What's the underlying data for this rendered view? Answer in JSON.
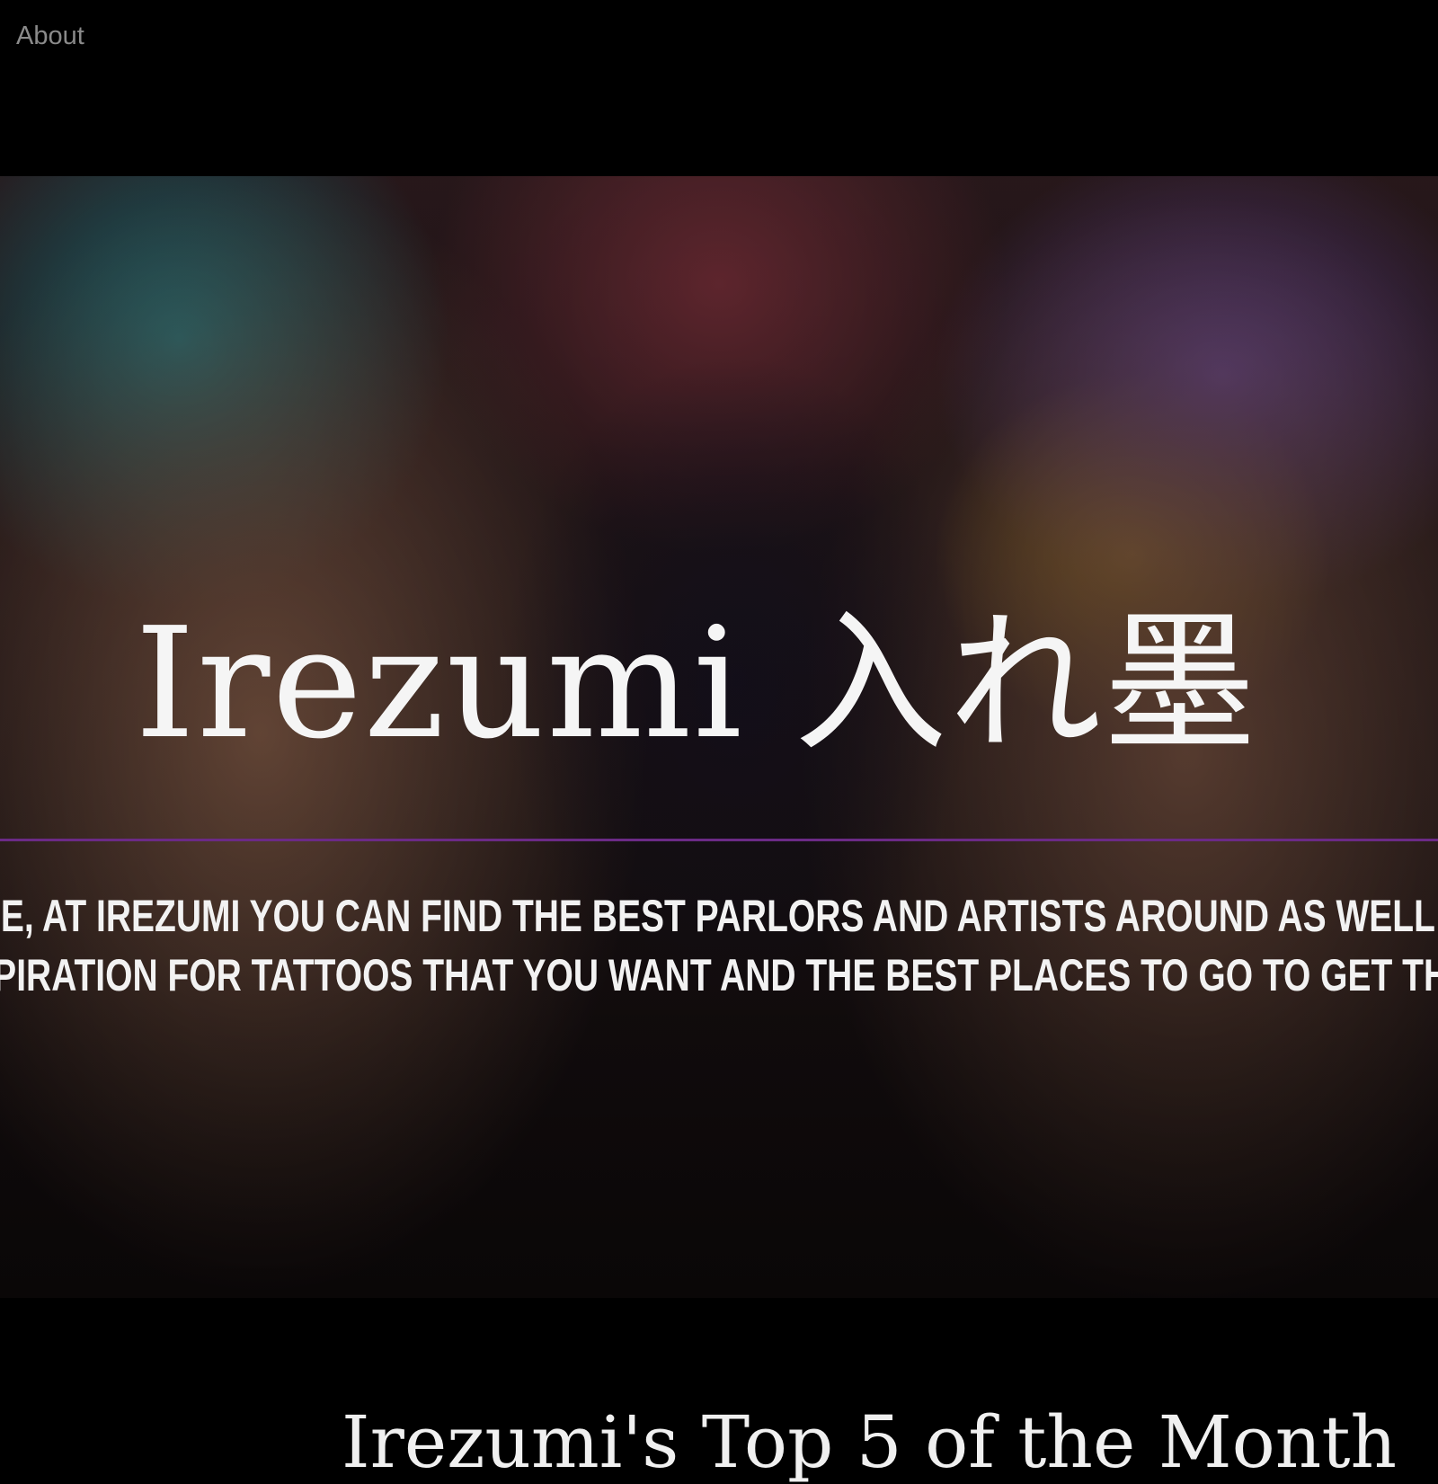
{
  "nav": {
    "about_label": "About"
  },
  "hero": {
    "title": "Irezumi 入れ墨",
    "tagline_lines": [
      "OME, AT IREZUMI YOU CAN FIND THE BEST PARLORS AND ARTISTS AROUND AS WELL AS GA",
      "NSPIRATION FOR TATTOOS THAT YOU WANT AND THE BEST PLACES TO GO TO GET THEM DO"
    ]
  },
  "colors": {
    "background": "#000000",
    "nav_text": "#8a8a8a",
    "hero_text": "#f5f5f5",
    "divider": "#6b2a86"
  },
  "section": {
    "heading": "Irezumi's Top 5 of the Month"
  }
}
